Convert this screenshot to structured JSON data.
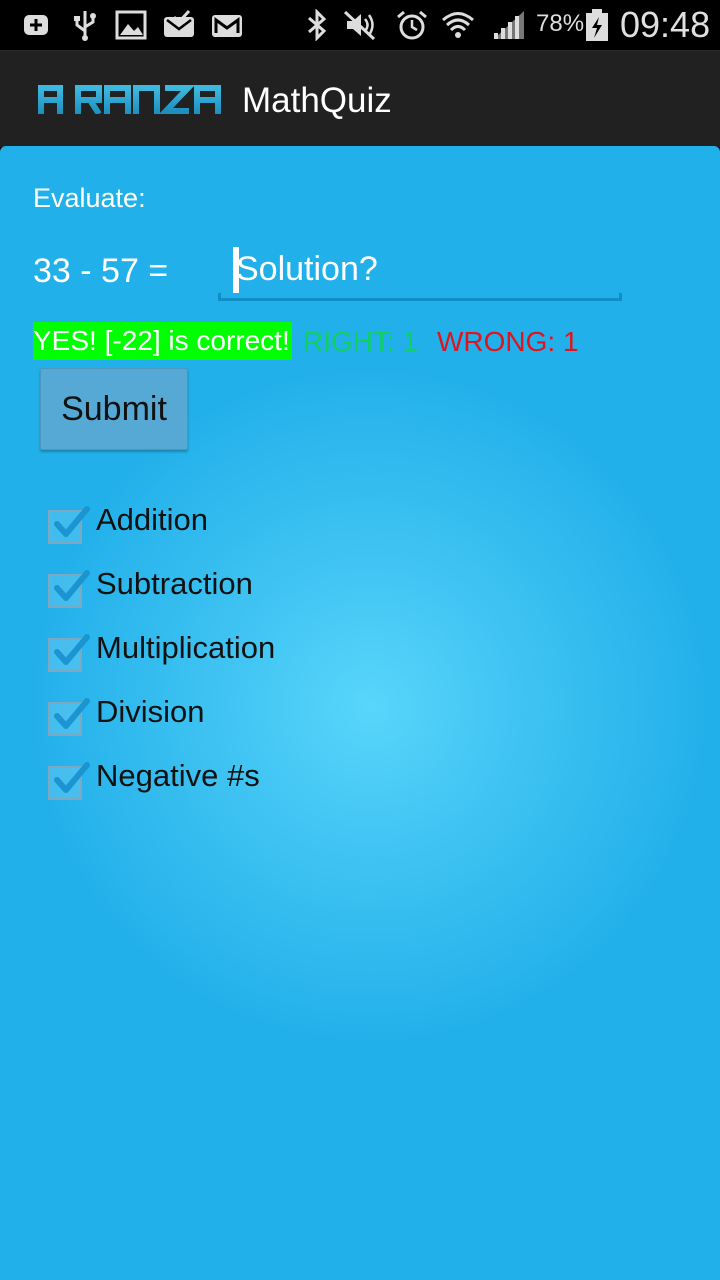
{
  "status_bar": {
    "battery_percent": "78%",
    "time": "09:48",
    "icons": [
      "plus-notification-icon",
      "usb-icon",
      "gallery-icon",
      "email-check-icon",
      "gmail-icon",
      "bluetooth-icon",
      "mute-icon",
      "alarm-icon",
      "wifi-icon",
      "signal-icon",
      "battery-icon"
    ]
  },
  "action_bar": {
    "brand": "AIRANZA",
    "title": "MathQuiz"
  },
  "quiz": {
    "evaluate_label": "Evaluate:",
    "equation": "33 - 57 =",
    "solution_placeholder": "Solution?",
    "result_message": "YES! [-22] is correct!",
    "right_label": "RIGHT: 1",
    "wrong_label": "WRONG: 1",
    "submit_label": "Submit"
  },
  "options": [
    {
      "label": "Addition",
      "checked": true
    },
    {
      "label": "Subtraction",
      "checked": true
    },
    {
      "label": "Multiplication",
      "checked": true
    },
    {
      "label": "Division",
      "checked": true
    },
    {
      "label": "Negative #s",
      "checked": true
    }
  ],
  "colors": {
    "panel": "#22b0ea",
    "result_bg": "#00ff00",
    "right": "#10d060",
    "wrong": "#e0141e"
  }
}
